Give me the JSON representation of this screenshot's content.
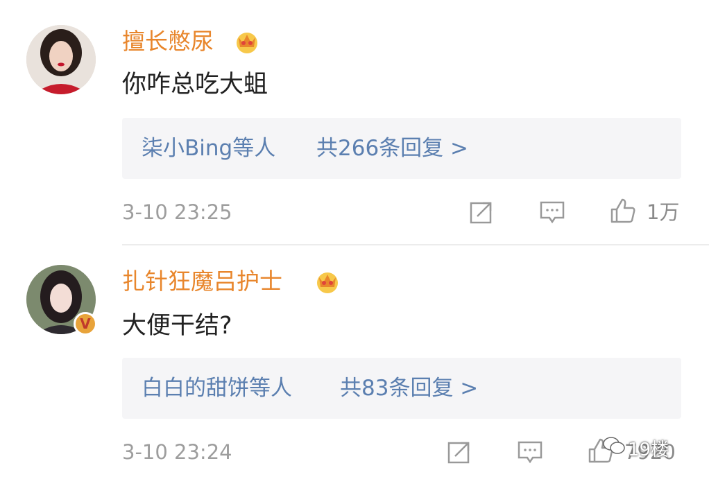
{
  "comments": [
    {
      "username": "擅长憋尿",
      "text": "你咋总吃大蛆",
      "replies_users": "柒小Bing等人",
      "replies_count": "共266条回复 >",
      "timestamp": "3-10 23:25",
      "likes": "1万",
      "avatar": "woman-red-lips-avatar",
      "verified": false
    },
    {
      "username": "扎针狂魔吕护士",
      "text": "大便干结?",
      "replies_users": "白白的甜饼等人",
      "replies_count": "共83条回复 >",
      "timestamp": "3-10 23:24",
      "likes": "7920",
      "avatar": "girl-long-hair-avatar",
      "verified": true,
      "verified_badge": "V"
    }
  ],
  "watermark": "19楼",
  "colors": {
    "username": "#e8862c",
    "reply_link": "#5b7fb0",
    "timestamp": "#9d9d9d",
    "reply_bg": "#f5f5f7"
  }
}
